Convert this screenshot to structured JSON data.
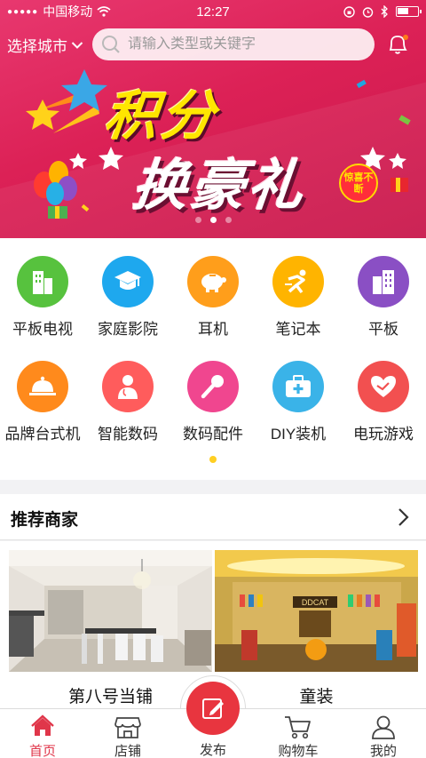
{
  "status_bar": {
    "carrier": "中国移动",
    "time": "12:27"
  },
  "header": {
    "city_label": "选择城市",
    "search_placeholder": "请输入类型或关键字"
  },
  "banner": {
    "line1": "积分",
    "line2": "换豪礼",
    "badge": "惊喜不断",
    "page_count": 3,
    "active_page": 2
  },
  "categories": {
    "row1": [
      {
        "label": "平板电视",
        "icon": "building-icon",
        "color": "#57c23e"
      },
      {
        "label": "家庭影院",
        "icon": "graduation-cap-icon",
        "color": "#1ea8ee"
      },
      {
        "label": "耳机",
        "icon": "piggy-bank-icon",
        "color": "#ff9e1b"
      },
      {
        "label": "笔记本",
        "icon": "runner-icon",
        "color": "#ffb400"
      },
      {
        "label": "平板",
        "icon": "office-building-icon",
        "color": "#8a4fc4"
      }
    ],
    "row2": [
      {
        "label": "品牌台式机",
        "icon": "food-cloche-icon",
        "color": "#ff8a1c"
      },
      {
        "label": "智能数码",
        "icon": "doctor-icon",
        "color": "#ff5c5c"
      },
      {
        "label": "数码配件",
        "icon": "microphone-icon",
        "color": "#f0468f"
      },
      {
        "label": "DIY装机",
        "icon": "first-aid-kit-icon",
        "color": "#3ab3e8"
      },
      {
        "label": "电玩游戏",
        "icon": "heart-hand-icon",
        "color": "#f25050"
      }
    ]
  },
  "recommend": {
    "title": "推荐商家",
    "shops": [
      {
        "name": "第八号当铺",
        "image": "dining-room-photo"
      },
      {
        "name": "童装",
        "image": "kids-clothing-store-photo",
        "store_sign": "DDCAT"
      }
    ]
  },
  "tabbar": {
    "items": [
      {
        "label": "首页",
        "icon": "home-icon"
      },
      {
        "label": "店铺",
        "icon": "shop-icon"
      },
      {
        "label": "发布",
        "icon": "edit-icon"
      },
      {
        "label": "购物车",
        "icon": "cart-icon"
      },
      {
        "label": "我的",
        "icon": "user-icon"
      }
    ],
    "active": "首页"
  }
}
